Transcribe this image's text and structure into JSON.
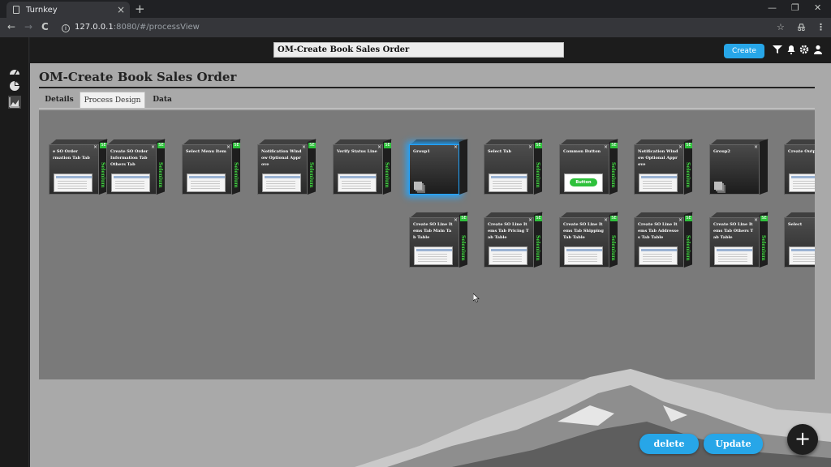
{
  "browser": {
    "tab_title": "Turnkey",
    "tab_close": "×",
    "new_tab": "+",
    "url_host": "127.0.0.1",
    "url_path": ":8080/#/processView",
    "back": "←",
    "forward": "→",
    "reload": "C",
    "minimize": "—",
    "restore": "❐",
    "close": "✕",
    "bookmark": "☆",
    "menu": "⋮"
  },
  "header": {
    "process_name": "OM-Create Book Sales Order",
    "create_label": "Create"
  },
  "page": {
    "title": "OM-Create Book Sales Order",
    "tabs": [
      {
        "label": "Details",
        "active": false
      },
      {
        "label": "Process Design",
        "active": true
      },
      {
        "label": "Data",
        "active": false
      }
    ]
  },
  "cards_row1": [
    {
      "name": "Create SO Order Information Tab Main Tab",
      "shown": "e SO Order rmation Tab Tab",
      "label": "Selenium",
      "kind": "step"
    },
    {
      "name": "Create SO Order Information Tab Others Tab",
      "shown": "Create SO Order Information Tab Others Tab",
      "label": "Selenium",
      "kind": "step"
    },
    {
      "name": "Select Menu Item",
      "shown": "Select Menu Item",
      "label": "Selenium",
      "kind": "step"
    },
    {
      "name": "Notification Window Optional Approve",
      "shown": "Notification Wind ow Optional Appr ove",
      "label": "Selenium",
      "kind": "step"
    },
    {
      "name": "Verify Status Line",
      "shown": "Verify Status Line",
      "label": "Selenium",
      "kind": "step"
    },
    {
      "name": "Group1",
      "shown": "Group1",
      "label": "",
      "kind": "group-selected"
    },
    {
      "name": "Select Tab",
      "shown": "Select Tab",
      "label": "Selenium",
      "kind": "step"
    },
    {
      "name": "Common Button",
      "shown": "Common Button",
      "label": "Selenium",
      "kind": "button",
      "button_text": "Button"
    },
    {
      "name": "Notification Window Optional Approve",
      "shown": "Notification Wind ow Optional Appr ove",
      "label": "Selenium",
      "kind": "step"
    },
    {
      "name": "Group2",
      "shown": "Group2",
      "label": "",
      "kind": "group"
    },
    {
      "name": "Create Output",
      "shown": "Create Outpu",
      "label": "",
      "kind": "step-cut"
    }
  ],
  "cards_row2": [
    {
      "name": "Create SO Line Items Tab Main Tab Table",
      "shown": "Create SO Line It ems Tab Main Ta b Table",
      "label": "Selenium"
    },
    {
      "name": "Create SO Line Items Tab Pricing Tab Table",
      "shown": "Create SO Line It ems Tab Pricing T ab Table",
      "label": "Selenium"
    },
    {
      "name": "Create SO Line Items Tab Shipping Tab Table",
      "shown": "Create SO Line It ems Tab Shipping Tab Table",
      "label": "Selenium"
    },
    {
      "name": "Create SO Line Items Tab Address Tab Table",
      "shown": "Create SO Line It ems Tab Addresse s Tab Table",
      "label": "Selenium"
    },
    {
      "name": "Create SO Line Items Tab Others Tab Table",
      "shown": "Create SO Line It ems Tab Others T ab Table",
      "label": "Selenium"
    },
    {
      "name": "Select",
      "shown": "Select",
      "label": "",
      "cut": true
    }
  ],
  "actions": {
    "delete_label": "delete",
    "update_label": "Update",
    "add_symbol": "+"
  },
  "card_badge": "SE",
  "card_close": "×",
  "colors": {
    "accent": "#27a6e8",
    "selenium_green": "#3fd33f",
    "selection_glow": "#22a5ff"
  }
}
